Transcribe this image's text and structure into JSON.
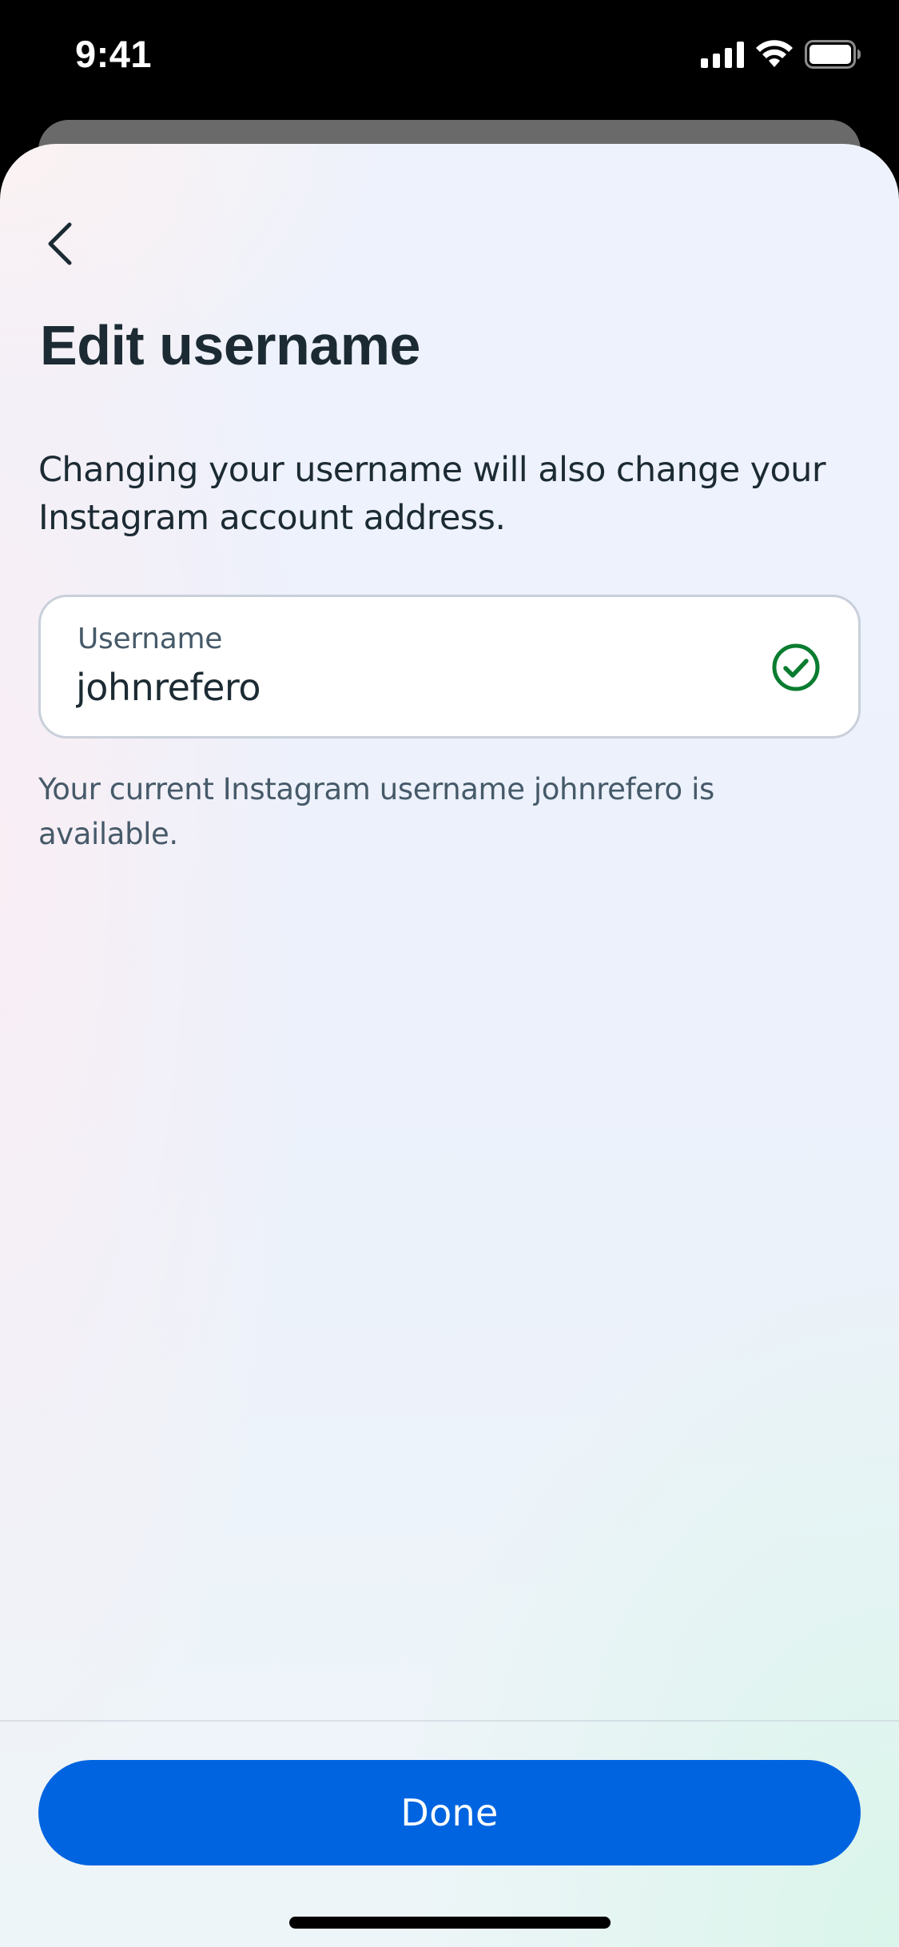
{
  "status_bar": {
    "time": "9:41"
  },
  "header": {
    "title": "Edit username"
  },
  "main": {
    "description": "Changing your username will also change your Instagram account address.",
    "username_field": {
      "label": "Username",
      "value": "johnrefero"
    },
    "helper_text": "Your current Instagram username johnrefero is available."
  },
  "footer": {
    "done_label": "Done"
  },
  "colors": {
    "primary_button": "#0064e0",
    "success_check": "#0a7c2f",
    "title_text": "#1c2b33",
    "secondary_text": "#465a69"
  },
  "icons": {
    "back": "chevron-left-icon",
    "valid": "check-circle-icon",
    "signal": "cellular-signal-icon",
    "wifi": "wifi-icon",
    "battery": "battery-icon"
  }
}
